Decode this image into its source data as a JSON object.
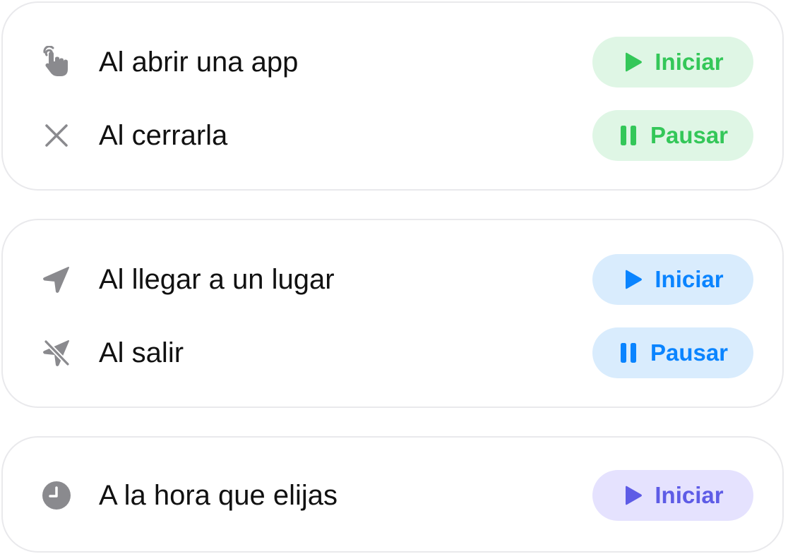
{
  "groups": [
    {
      "rows": [
        {
          "icon": "hand-tap-icon",
          "label": "Al abrir una app",
          "button": {
            "label": "Iniciar",
            "icon": "play-icon",
            "color": "#34c759"
          }
        },
        {
          "icon": "close-x-icon",
          "label": "Al cerrarla",
          "button": {
            "label": "Pausar",
            "icon": "pause-icon",
            "color": "#34c759"
          }
        }
      ]
    },
    {
      "rows": [
        {
          "icon": "location-arrow-icon",
          "label": "Al llegar a un lugar",
          "button": {
            "label": "Iniciar",
            "icon": "play-icon",
            "color": "#0a84ff"
          }
        },
        {
          "icon": "location-arrow-slash-icon",
          "label": "Al salir",
          "button": {
            "label": "Pausar",
            "icon": "pause-icon",
            "color": "#0a84ff"
          }
        }
      ]
    },
    {
      "rows": [
        {
          "icon": "clock-icon",
          "label": "A la hora que elijas",
          "button": {
            "label": "Iniciar",
            "icon": "play-icon",
            "color": "#5e5ce6"
          }
        }
      ]
    }
  ],
  "colors": {
    "icon_gray": "#8a8a8e",
    "card_border": "#e9e9ec",
    "green_bg": "#dff6e5",
    "blue_bg": "#d9ecfd",
    "purple_bg": "#e5e2fe"
  }
}
